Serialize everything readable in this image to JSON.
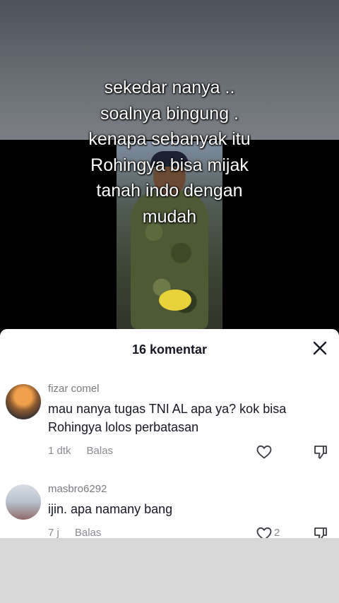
{
  "video": {
    "caption_lines": [
      "sekedar nanya ..",
      "soalnya bingung .",
      "kenapa sebanyak itu",
      "Rohingya bisa mijak",
      "tanah indo dengan",
      "mudah"
    ]
  },
  "comments_sheet": {
    "title": "16 komentar",
    "close_icon": "close-icon"
  },
  "comments": [
    {
      "username": "fizar comel",
      "text_lines": [
        "mau nanya tugas TNI AL apa ya? kok bisa",
        "Rohingya lolos perbatasan"
      ],
      "time": "1 dtk",
      "reply_label": "Balas",
      "like_count": ""
    },
    {
      "username": "masbro6292",
      "text_lines": [
        "ijin. apa namany bang"
      ],
      "time": "7 j",
      "reply_label": "Balas",
      "like_count": "2"
    }
  ]
}
